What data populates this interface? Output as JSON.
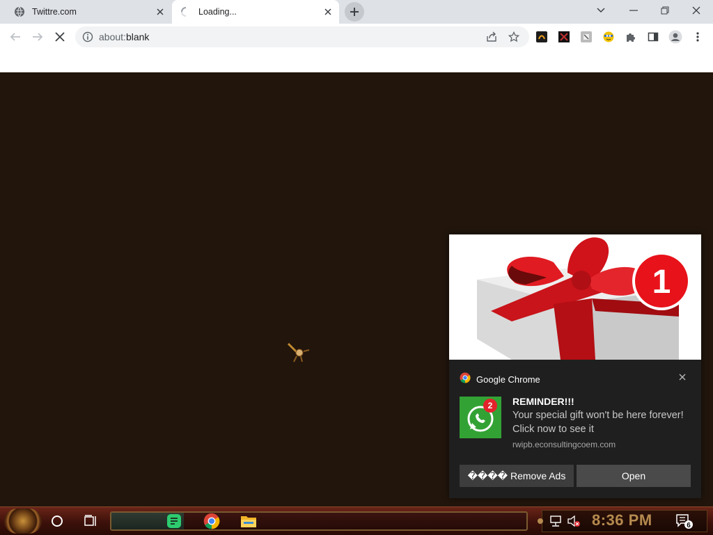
{
  "browser": {
    "tabs": [
      {
        "title": "Twittre.com",
        "icon": "globe-icon",
        "active": false
      },
      {
        "title": "Loading...",
        "icon": "spinner-icon",
        "active": true
      }
    ],
    "address_scheme": "about:",
    "address_path": "blank",
    "extensions": [
      "extension-icon-1",
      "extension-icon-2",
      "extension-icon-3",
      "extension-icon-4",
      "puzzle-icon",
      "side-panel-icon",
      "profile-icon",
      "menu-icon"
    ]
  },
  "notification": {
    "app_name": "Google Chrome",
    "hero_badge": "1",
    "icon_badge": "2",
    "title": "REMINDER!!!",
    "body": "Your special gift won't be here forever! Click now to see it",
    "source": "rwipb.econsultingcoem.com",
    "buttons": {
      "remove_ads": "���� Remove Ads",
      "open": "Open"
    }
  },
  "taskbar": {
    "clock": "8:36 PM",
    "notification_count": "6"
  },
  "colors": {
    "page_background": "#21150c",
    "notification_bg": "#1f1f1f",
    "whatsapp_green": "#33a235",
    "badge_red": "#e3232c"
  }
}
